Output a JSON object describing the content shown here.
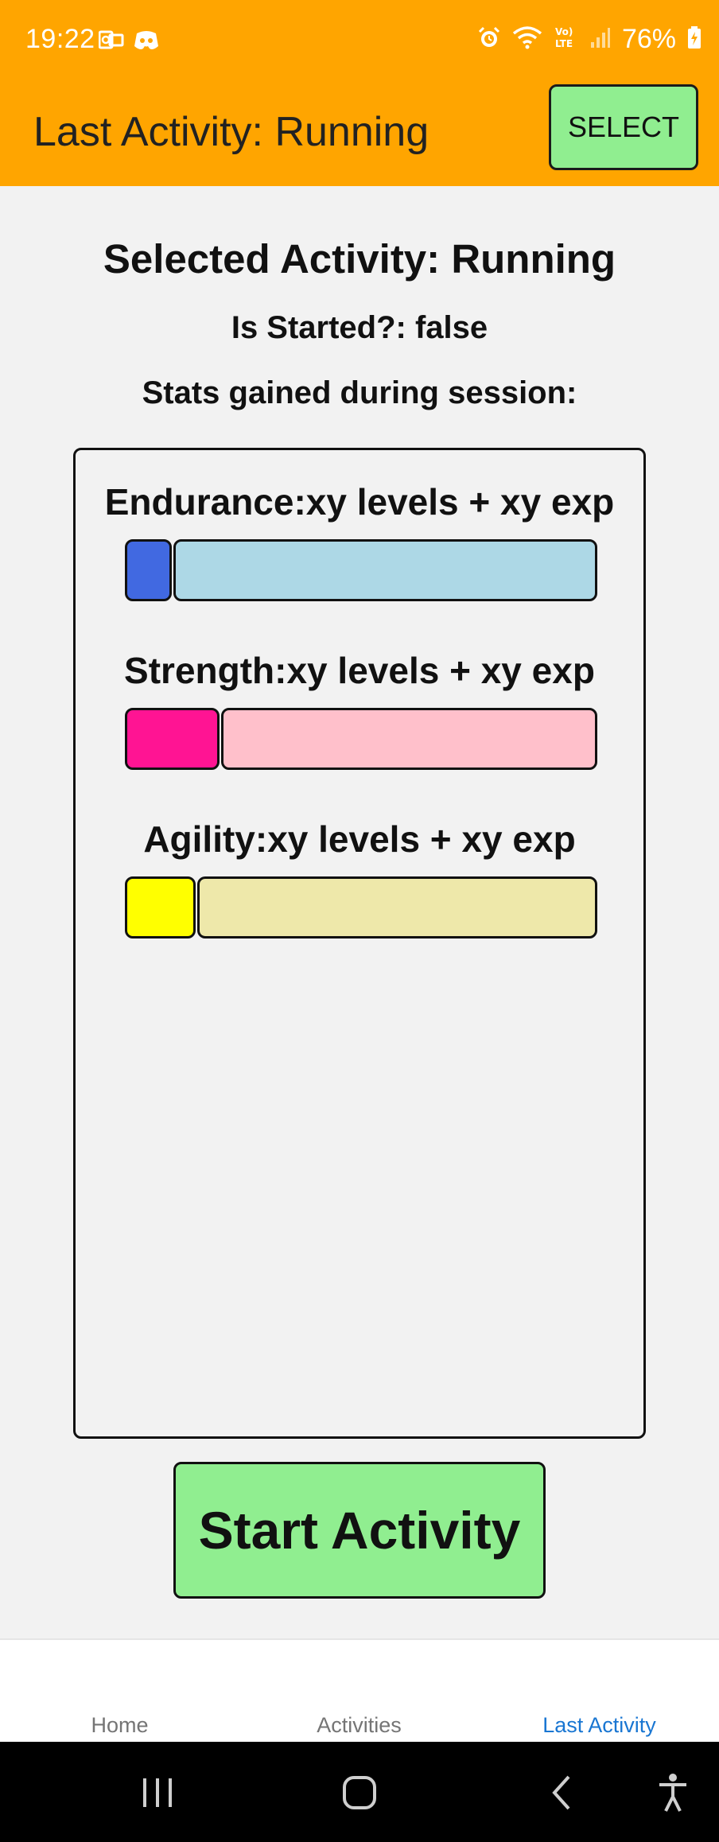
{
  "status_bar": {
    "time": "19:22",
    "battery": "76%",
    "icons": [
      "outlook-icon",
      "discord-icon",
      "alarm-icon",
      "wifi-icon",
      "volte-icon",
      "signal-icon",
      "battery-icon"
    ]
  },
  "app_bar": {
    "title": "Last Activity: Running",
    "select_label": "SELECT",
    "background_color": "#ffa500"
  },
  "main": {
    "selected_activity": "Selected Activity: Running",
    "is_started": "Is Started?: false",
    "stats_heading": "Stats gained during session:",
    "stats": [
      {
        "label": "Endurance:xy levels + xy exp",
        "fill_color": "#4169e1",
        "track_color": "#add8e6",
        "progress": 0.1
      },
      {
        "label": "Strength:xy levels + xy exp",
        "fill_color": "#ff1493",
        "track_color": "#ffc0cb",
        "progress": 0.2
      },
      {
        "label": "Agility:xy levels + xy exp",
        "fill_color": "#ffff00",
        "track_color": "#eee8aa",
        "progress": 0.15
      }
    ],
    "start_button_label": "Start Activity",
    "button_color": "#90ee90"
  },
  "bottom_nav": {
    "items": [
      {
        "label": "Home",
        "active": false
      },
      {
        "label": "Activities",
        "active": false
      },
      {
        "label": "Last Activity",
        "active": true
      }
    ],
    "active_color": "#1976d2"
  },
  "system_nav": {
    "buttons": [
      "recent-apps-icon",
      "home-icon",
      "back-icon",
      "accessibility-icon"
    ]
  }
}
